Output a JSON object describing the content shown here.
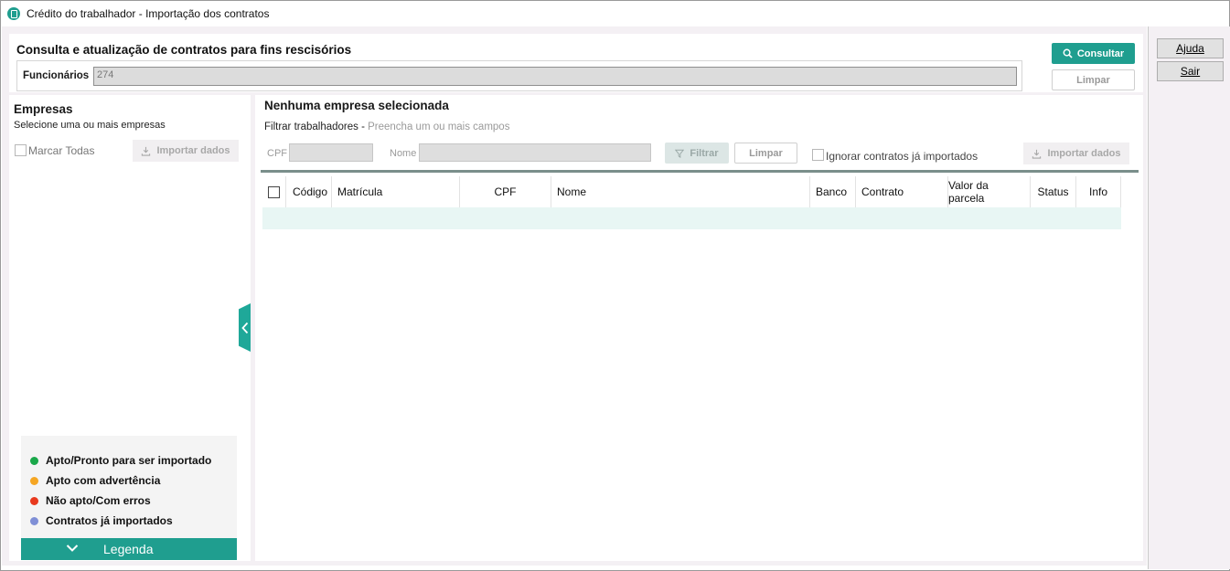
{
  "window": {
    "title": "Crédito do trabalhador - Importação dos contratos"
  },
  "side_buttons": {
    "help": "Ajuda",
    "exit": "Sair"
  },
  "top": {
    "section_title": "Consulta e atualização de contratos para fins rescisórios",
    "employees_label": "Funcionários",
    "employees_value": "274",
    "consult_label": "Consultar",
    "clear_label": "Limpar"
  },
  "companies": {
    "title": "Empresas",
    "subtitle": "Selecione uma ou mais empresas",
    "select_all_label": "Marcar Todas",
    "import_label": "Importar dados"
  },
  "legend": {
    "items": [
      {
        "label": "Apto/Pronto para ser importado",
        "color": "#1aa84a"
      },
      {
        "label": "Apto com advertência",
        "color": "#f5a623"
      },
      {
        "label": "Não apto/Com erros",
        "color": "#e8391e"
      },
      {
        "label": "Contratos já importados",
        "color": "#7f8fd6"
      }
    ],
    "toggle_label": "Legenda"
  },
  "main": {
    "title": "Nenhuma empresa selecionada",
    "filter_caption": "Filtrar trabalhadores - ",
    "filter_hint": "Preencha um ou mais campos",
    "cpf_label": "CPF",
    "name_label": "Nome",
    "filter_button": "Filtrar",
    "clear_button": "Limpar",
    "ignore_label": "Ignorar contratos já importados",
    "import_label": "Importar dados"
  },
  "table": {
    "columns": [
      "Código",
      "Matrícula",
      "CPF",
      "Nome",
      "Banco",
      "Contrato",
      "Valor da parcela",
      "Status",
      "Info"
    ]
  },
  "colors": {
    "accent": "#1f9e8f",
    "row_highlight": "#e8f6f4"
  }
}
